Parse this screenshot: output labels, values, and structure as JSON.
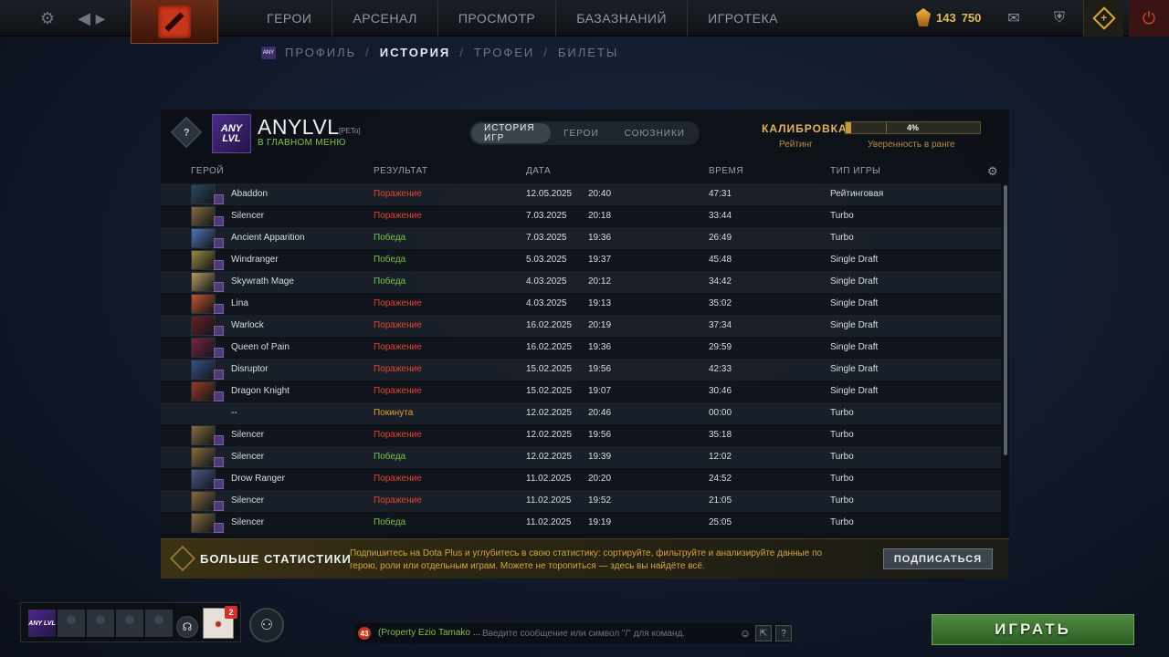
{
  "topbar": {
    "nav": [
      "ГЕРОИ",
      "АРСЕНАЛ",
      "ПРОСМОТР",
      "БАЗАЗНАНИЙ",
      "ИГРОТЕКА"
    ],
    "shards": "143",
    "gold": "750"
  },
  "subnav": {
    "items": [
      "ПРОФИЛЬ",
      "ИСТОРИЯ",
      "ТРОФЕИ",
      "БИЛЕТЫ"
    ],
    "separator": "/"
  },
  "profile": {
    "avatar_text": "ANY LVL",
    "name": "ANYLVL",
    "tag": "[PETo]",
    "status": "В ГЛАВНОМ МЕНЮ",
    "medal": "?"
  },
  "tabs": [
    "ИСТОРИЯ ИГР",
    "ГЕРОИ",
    "СОЮЗНИКИ"
  ],
  "calibration": {
    "title": "КАЛИБРОВКА",
    "rating_label": "Рейтинг",
    "confidence_value": "4%",
    "confidence_fraction": 0.04,
    "confidence_label": "Уверенность в ранге"
  },
  "columns": {
    "hero": "ГЕРОЙ",
    "result": "РЕЗУЛЬТАТ",
    "date": "ДАТА",
    "duration": "ВРЕМЯ",
    "type": "ТИП ИГРЫ"
  },
  "matches": [
    {
      "hero": "Abaddon",
      "result": "Поражение",
      "outcome": "loss",
      "date": "12.05.2025",
      "time": "20:40",
      "duration": "47:31",
      "type": "Рейтинговая",
      "color": "#2c4860"
    },
    {
      "hero": "Silencer",
      "result": "Поражение",
      "outcome": "loss",
      "date": "7.03.2025",
      "time": "20:18",
      "duration": "33:44",
      "type": "Turbo",
      "color": "#8a6a3c"
    },
    {
      "hero": "Ancient Apparition",
      "result": "Победа",
      "outcome": "win",
      "date": "7.03.2025",
      "time": "19:36",
      "duration": "26:49",
      "type": "Turbo",
      "color": "#4f76b8"
    },
    {
      "hero": "Windranger",
      "result": "Победа",
      "outcome": "win",
      "date": "5.03.2025",
      "time": "19:37",
      "duration": "45:48",
      "type": "Single Draft",
      "color": "#9a8a3c"
    },
    {
      "hero": "Skywrath Mage",
      "result": "Победа",
      "outcome": "win",
      "date": "4.03.2025",
      "time": "20:12",
      "duration": "34:42",
      "type": "Single Draft",
      "color": "#b89a5a"
    },
    {
      "hero": "Lina",
      "result": "Поражение",
      "outcome": "loss",
      "date": "4.03.2025",
      "time": "19:13",
      "duration": "35:02",
      "type": "Single Draft",
      "color": "#c2542c"
    },
    {
      "hero": "Warlock",
      "result": "Поражение",
      "outcome": "loss",
      "date": "16.02.2025",
      "time": "20:19",
      "duration": "37:34",
      "type": "Single Draft",
      "color": "#6a1f24"
    },
    {
      "hero": "Queen of Pain",
      "result": "Поражение",
      "outcome": "loss",
      "date": "16.02.2025",
      "time": "19:36",
      "duration": "29:59",
      "type": "Single Draft",
      "color": "#7a2440"
    },
    {
      "hero": "Disruptor",
      "result": "Поражение",
      "outcome": "loss",
      "date": "15.02.2025",
      "time": "19:56",
      "duration": "42:33",
      "type": "Single Draft",
      "color": "#3a4f8a"
    },
    {
      "hero": "Dragon Knight",
      "result": "Поражение",
      "outcome": "loss",
      "date": "15.02.2025",
      "time": "19:07",
      "duration": "30:46",
      "type": "Single Draft",
      "color": "#9a3a22"
    },
    {
      "hero": "--",
      "result": "Покинута",
      "outcome": "leave",
      "date": "12.02.2025",
      "time": "20:46",
      "duration": "00:00",
      "type": "Turbo",
      "color": ""
    },
    {
      "hero": "Silencer",
      "result": "Поражение",
      "outcome": "loss",
      "date": "12.02.2025",
      "time": "19:56",
      "duration": "35:18",
      "type": "Turbo",
      "color": "#8a6a3c"
    },
    {
      "hero": "Silencer",
      "result": "Победа",
      "outcome": "win",
      "date": "12.02.2025",
      "time": "19:39",
      "duration": "12:02",
      "type": "Turbo",
      "color": "#8a6a3c"
    },
    {
      "hero": "Drow Ranger",
      "result": "Поражение",
      "outcome": "loss",
      "date": "11.02.2025",
      "time": "20:20",
      "duration": "24:52",
      "type": "Turbo",
      "color": "#4a5a8a"
    },
    {
      "hero": "Silencer",
      "result": "Поражение",
      "outcome": "loss",
      "date": "11.02.2025",
      "time": "19:52",
      "duration": "21:05",
      "type": "Turbo",
      "color": "#8a6a3c"
    },
    {
      "hero": "Silencer",
      "result": "Победа",
      "outcome": "win",
      "date": "11.02.2025",
      "time": "19:19",
      "duration": "25:05",
      "type": "Turbo",
      "color": "#8a6a3c"
    }
  ],
  "promo": {
    "title": "БОЛЬШЕ СТАТИСТИКИ",
    "text": "Подпишитесь на Dota Plus и углубитесь в свою статистику: сортируйте, фильтруйте и анализируйте данные по герою, роли или отдельным играм. Можете не торопиться — здесь вы найдёте всё.",
    "button": "ПОДПИСАТЬСЯ"
  },
  "party": {
    "avatar_text": "ANY LVL",
    "guild_badge": "2"
  },
  "chat": {
    "unread": "43",
    "channel": "(Property Ezio Tamako ...",
    "placeholder": "Введите сообщение или символ \"/\" для команд."
  },
  "play_button": "ИГРАТЬ",
  "colors": {
    "win": "#79c24a",
    "loss": "#e0452f",
    "leave": "#e59e2e",
    "accent": "#e5b45a"
  }
}
